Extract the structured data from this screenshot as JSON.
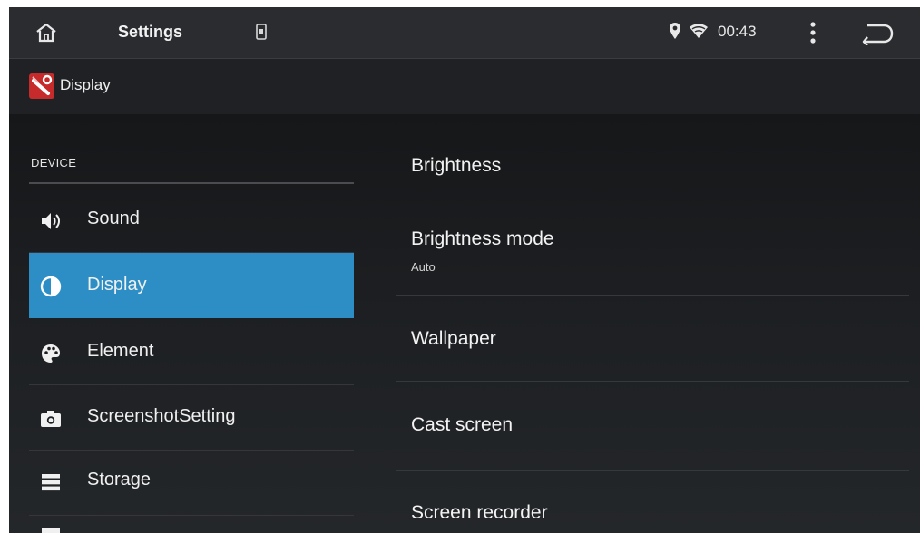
{
  "statusbar": {
    "title": "Settings",
    "time": "00:43",
    "icons": {
      "home": "home-icon",
      "sim": "sim-card-icon",
      "location": "location-pin-icon",
      "wifi": "wifi-icon",
      "more": "more-vert-icon",
      "back": "back-arrow-icon"
    }
  },
  "header": {
    "label": "Display",
    "icon": "settings-wrench-icon"
  },
  "sidebar": {
    "section": "DEVICE",
    "items": [
      {
        "label": "Sound",
        "icon": "speaker-icon",
        "active": false
      },
      {
        "label": "Display",
        "icon": "contrast-icon",
        "active": true
      },
      {
        "label": "Element",
        "icon": "palette-icon",
        "active": false
      },
      {
        "label": "ScreenshotSetting",
        "icon": "camera-icon",
        "active": false
      },
      {
        "label": "Storage",
        "icon": "storage-icon",
        "active": false
      }
    ]
  },
  "main": {
    "prefs": [
      {
        "title": "Brightness",
        "summary": ""
      },
      {
        "title": "Brightness mode",
        "summary": "Auto"
      },
      {
        "title": "Wallpaper",
        "summary": ""
      },
      {
        "title": "Cast screen",
        "summary": ""
      },
      {
        "title": "Screen recorder",
        "summary": ""
      }
    ]
  },
  "colors": {
    "accent": "#2c8ec4",
    "background": "#1a1c1f",
    "statusbar": "#2a2c2f",
    "text": "#f0f0f0"
  }
}
